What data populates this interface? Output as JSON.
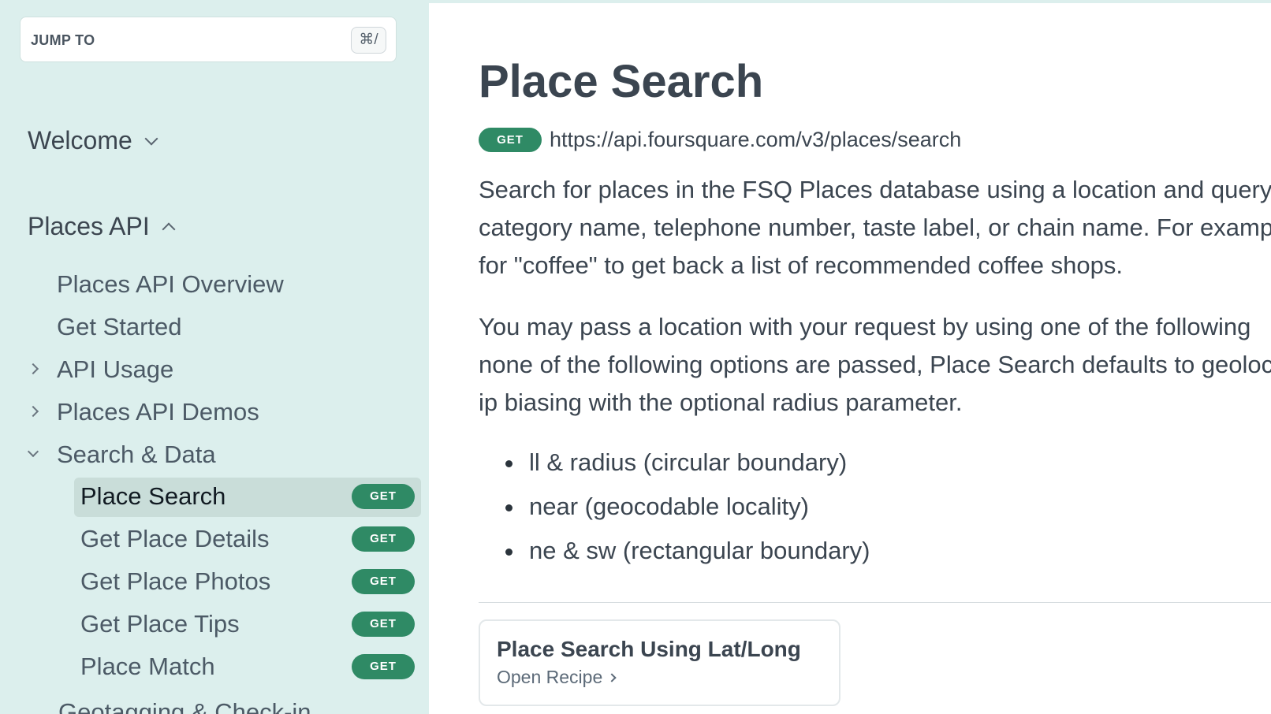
{
  "sidebar": {
    "jump_label": "JUMP TO",
    "jump_shortcut": "⌘/",
    "sections": [
      {
        "label": "Welcome",
        "expanded": false
      },
      {
        "label": "Places API",
        "expanded": true
      }
    ],
    "items": [
      {
        "label": "Places API Overview"
      },
      {
        "label": "Get Started"
      },
      {
        "label": "API Usage",
        "expander": "collapsed"
      },
      {
        "label": "Places API Demos",
        "expander": "collapsed"
      },
      {
        "label": "Search & Data",
        "expander": "expanded"
      }
    ],
    "sub_items": [
      {
        "label": "Place Search",
        "badge": "GET",
        "active": true
      },
      {
        "label": "Get Place Details",
        "badge": "GET"
      },
      {
        "label": "Get Place Photos",
        "badge": "GET"
      },
      {
        "label": "Get Place Tips",
        "badge": "GET"
      },
      {
        "label": "Place Match",
        "badge": "GET"
      }
    ],
    "next_section_partial": "Geotagging & Check-in"
  },
  "main": {
    "title": "Place Search",
    "method": "GET",
    "url": "https://api.foursquare.com/v3/places/search",
    "paragraph1_lines": [
      "Search for places in the FSQ Places database using a location and query",
      "category name, telephone number, taste label, or chain name. For example",
      "for \"coffee\" to get back a list of recommended coffee shops."
    ],
    "paragraph2_lines": [
      "You may pass a location with your request by using one of the following",
      "none of the following options are passed, Place Search defaults to geolocation",
      "ip biasing with the optional radius parameter."
    ],
    "bullets": [
      "ll & radius (circular boundary)",
      "near (geocodable locality)",
      "ne & sw (rectangular boundary)"
    ],
    "recipe": {
      "title": "Place Search Using Lat/Long",
      "link_label": "Open Recipe"
    }
  },
  "colors": {
    "sidebar_bg": "#dcefed",
    "active_bg": "#c9ddd9",
    "badge_green": "#2f8a65",
    "text": "#3b4550"
  }
}
